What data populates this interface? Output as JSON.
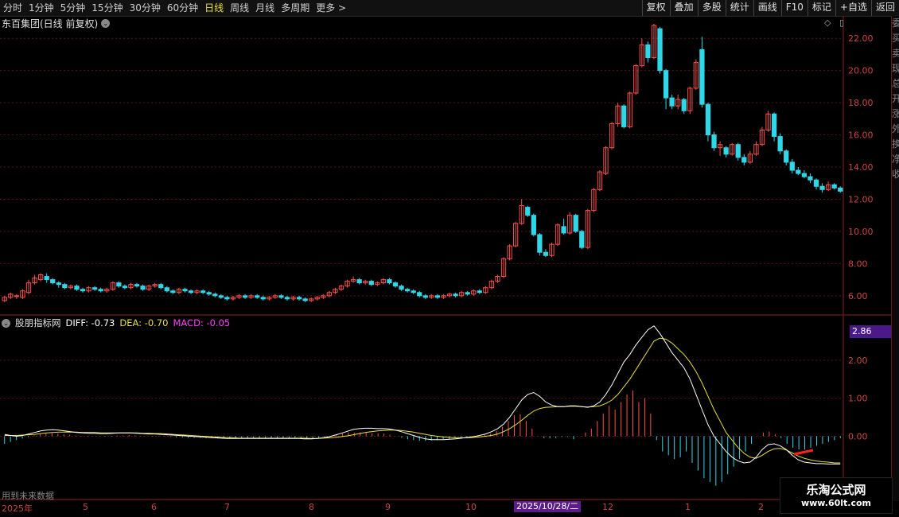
{
  "toolbar": {
    "tabs": [
      {
        "label": "分时",
        "active": false
      },
      {
        "label": "1分钟",
        "active": false
      },
      {
        "label": "5分钟",
        "active": false
      },
      {
        "label": "15分钟",
        "active": false
      },
      {
        "label": "30分钟",
        "active": false
      },
      {
        "label": "60分钟",
        "active": false
      },
      {
        "label": "日线",
        "active": true
      },
      {
        "label": "周线",
        "active": false
      },
      {
        "label": "月线",
        "active": false
      },
      {
        "label": "多周期",
        "active": false
      },
      {
        "label": "更多 >",
        "active": false
      }
    ],
    "buttons": [
      "复权",
      "叠加",
      "多股",
      "统计",
      "画线",
      "F10",
      "标记",
      "+自选",
      "返回"
    ]
  },
  "stock": {
    "title": "东百集团(日线 前复权)"
  },
  "indicator": {
    "name": "股朋指标网",
    "diff": "DIFF: -0.73",
    "dea": "DEA: -0.70",
    "macd": "MACD: -0.05",
    "current_value": "2.86"
  },
  "price_axis": {
    "labels": [
      "22.00",
      "20.00",
      "18.00",
      "16.00",
      "14.00",
      "12.00",
      "10.00",
      "8.00",
      "6.00"
    ]
  },
  "macd_axis": {
    "labels": [
      "2.00",
      "1.00",
      "0.00"
    ]
  },
  "x_axis": {
    "labels": [
      "2025年",
      "5",
      "6",
      "7",
      "8",
      "9",
      "10",
      "12",
      "1",
      "2"
    ],
    "cursor_date": "2025/10/28/二"
  },
  "footer": {
    "note": "用到未来数据"
  },
  "watermark": {
    "line1": "乐淘公式网",
    "line2": "www.60lt.com"
  },
  "right_strip": [
    "委",
    "买",
    "卖",
    "现",
    "总",
    "开",
    "涨",
    "外",
    "换",
    "净",
    "收"
  ],
  "colors": {
    "up": "#ff4d4d",
    "down": "#2fd7e8",
    "diff": "#ffffff",
    "dea": "#e8e23a",
    "macd": "#ff40ff",
    "grid": "#5a1414"
  },
  "chart_data": {
    "type": "candlestick",
    "ylim": [
      5.2,
      23.0
    ],
    "candles": [
      [
        5.7,
        5.9,
        5.6,
        6.0
      ],
      [
        5.9,
        6.1,
        5.8,
        6.2
      ],
      [
        6.0,
        6.0,
        5.8,
        6.1
      ],
      [
        5.9,
        6.3,
        5.8,
        6.4
      ],
      [
        6.2,
        6.8,
        6.1,
        7.0
      ],
      [
        6.8,
        7.1,
        6.7,
        7.3
      ],
      [
        7.0,
        7.3,
        6.9,
        7.4
      ],
      [
        7.2,
        7.0,
        6.8,
        7.4
      ],
      [
        7.0,
        6.8,
        6.7,
        7.1
      ],
      [
        6.8,
        6.7,
        6.5,
        6.9
      ],
      [
        6.7,
        6.5,
        6.4,
        6.8
      ],
      [
        6.5,
        6.6,
        6.4,
        6.7
      ],
      [
        6.6,
        6.4,
        6.3,
        6.7
      ],
      [
        6.4,
        6.3,
        6.2,
        6.5
      ],
      [
        6.3,
        6.5,
        6.2,
        6.6
      ],
      [
        6.5,
        6.4,
        6.3,
        6.6
      ],
      [
        6.4,
        6.3,
        6.2,
        6.5
      ],
      [
        6.3,
        6.4,
        6.2,
        6.5
      ],
      [
        6.4,
        6.8,
        6.3,
        6.9
      ],
      [
        6.8,
        6.6,
        6.5,
        6.9
      ],
      [
        6.6,
        6.5,
        6.4,
        6.7
      ],
      [
        6.5,
        6.7,
        6.4,
        6.8
      ],
      [
        6.7,
        6.6,
        6.5,
        6.8
      ],
      [
        6.6,
        6.4,
        6.3,
        6.7
      ],
      [
        6.4,
        6.6,
        6.3,
        6.7
      ],
      [
        6.6,
        6.7,
        6.5,
        6.8
      ],
      [
        6.7,
        6.5,
        6.4,
        6.8
      ],
      [
        6.5,
        6.3,
        6.2,
        6.6
      ],
      [
        6.3,
        6.2,
        6.1,
        6.4
      ],
      [
        6.2,
        6.4,
        6.1,
        6.5
      ],
      [
        6.4,
        6.3,
        6.2,
        6.5
      ],
      [
        6.3,
        6.2,
        6.1,
        6.4
      ],
      [
        6.2,
        6.3,
        6.1,
        6.4
      ],
      [
        6.3,
        6.2,
        6.1,
        6.4
      ],
      [
        6.2,
        6.1,
        6.0,
        6.3
      ],
      [
        6.1,
        6.0,
        5.9,
        6.2
      ],
      [
        6.0,
        5.9,
        5.8,
        6.1
      ],
      [
        5.9,
        5.8,
        5.7,
        6.0
      ],
      [
        5.8,
        5.9,
        5.7,
        6.0
      ],
      [
        5.9,
        6.0,
        5.8,
        6.1
      ],
      [
        6.0,
        5.9,
        5.8,
        6.1
      ],
      [
        5.9,
        6.0,
        5.8,
        6.1
      ],
      [
        6.0,
        5.9,
        5.8,
        6.1
      ],
      [
        5.9,
        5.8,
        5.7,
        6.0
      ],
      [
        5.8,
        5.9,
        5.7,
        6.0
      ],
      [
        5.9,
        6.0,
        5.8,
        6.1
      ],
      [
        6.0,
        5.9,
        5.8,
        6.1
      ],
      [
        5.9,
        5.8,
        5.7,
        6.0
      ],
      [
        5.8,
        5.9,
        5.7,
        6.0
      ],
      [
        5.9,
        5.8,
        5.7,
        6.0
      ],
      [
        5.8,
        5.7,
        5.6,
        5.9
      ],
      [
        5.7,
        5.8,
        5.6,
        5.9
      ],
      [
        5.8,
        5.9,
        5.7,
        6.0
      ],
      [
        5.9,
        6.0,
        5.8,
        6.1
      ],
      [
        6.0,
        6.2,
        5.9,
        6.3
      ],
      [
        6.2,
        6.4,
        6.1,
        6.5
      ],
      [
        6.4,
        6.6,
        6.3,
        6.7
      ],
      [
        6.6,
        6.9,
        6.5,
        7.0
      ],
      [
        6.9,
        7.0,
        6.8,
        7.2
      ],
      [
        7.0,
        6.8,
        6.7,
        7.1
      ],
      [
        6.8,
        6.9,
        6.7,
        7.0
      ],
      [
        6.9,
        6.7,
        6.6,
        7.0
      ],
      [
        6.7,
        6.8,
        6.6,
        6.9
      ],
      [
        6.8,
        7.0,
        6.7,
        7.1
      ],
      [
        7.0,
        6.8,
        6.7,
        7.1
      ],
      [
        6.8,
        6.6,
        6.5,
        6.9
      ],
      [
        6.6,
        6.4,
        6.3,
        6.7
      ],
      [
        6.4,
        6.3,
        6.2,
        6.5
      ],
      [
        6.3,
        6.2,
        6.1,
        6.4
      ],
      [
        6.2,
        6.0,
        5.9,
        6.3
      ],
      [
        6.0,
        5.9,
        5.8,
        6.1
      ],
      [
        5.9,
        6.0,
        5.8,
        6.1
      ],
      [
        6.0,
        5.9,
        5.8,
        6.1
      ],
      [
        5.9,
        6.0,
        5.8,
        6.1
      ],
      [
        6.0,
        6.1,
        5.9,
        6.2
      ],
      [
        6.1,
        6.0,
        5.9,
        6.2
      ],
      [
        6.0,
        6.2,
        5.9,
        6.3
      ],
      [
        6.2,
        6.1,
        6.0,
        6.3
      ],
      [
        6.1,
        6.3,
        6.0,
        6.4
      ],
      [
        6.3,
        6.2,
        6.1,
        6.4
      ],
      [
        6.2,
        6.5,
        6.1,
        6.6
      ],
      [
        6.5,
        6.9,
        6.4,
        7.0
      ],
      [
        6.9,
        7.2,
        6.8,
        7.3
      ],
      [
        7.2,
        8.3,
        7.1,
        8.4
      ],
      [
        8.3,
        9.1,
        8.2,
        9.2
      ],
      [
        9.1,
        10.5,
        9.0,
        10.6
      ],
      [
        10.5,
        11.6,
        10.4,
        12.0
      ],
      [
        11.5,
        11.0,
        10.9,
        11.6
      ],
      [
        11.0,
        9.8,
        9.7,
        11.1
      ],
      [
        9.8,
        8.7,
        8.5,
        9.9
      ],
      [
        8.7,
        8.5,
        8.4,
        8.9
      ],
      [
        8.5,
        9.2,
        8.4,
        9.3
      ],
      [
        9.2,
        10.4,
        9.1,
        10.5
      ],
      [
        10.3,
        9.9,
        9.8,
        10.8
      ],
      [
        9.9,
        11.0,
        9.8,
        11.2
      ],
      [
        11.0,
        10.0,
        9.9,
        11.1
      ],
      [
        10.0,
        9.0,
        8.9,
        10.1
      ],
      [
        9.0,
        11.3,
        8.9,
        11.4
      ],
      [
        11.3,
        12.6,
        11.2,
        12.7
      ],
      [
        12.6,
        13.7,
        12.5,
        13.8
      ],
      [
        13.6,
        15.2,
        13.5,
        15.3
      ],
      [
        15.2,
        16.7,
        15.1,
        16.8
      ],
      [
        16.7,
        17.8,
        16.5,
        18.0
      ],
      [
        17.8,
        16.5,
        16.4,
        17.9
      ],
      [
        16.5,
        18.6,
        16.4,
        18.7
      ],
      [
        18.6,
        20.3,
        18.5,
        20.4
      ],
      [
        20.3,
        21.6,
        20.2,
        22.0
      ],
      [
        21.6,
        20.8,
        20.5,
        21.8
      ],
      [
        20.8,
        22.8,
        20.7,
        22.9
      ],
      [
        22.6,
        20.0,
        19.8,
        22.7
      ],
      [
        20.0,
        18.3,
        17.6,
        20.1
      ],
      [
        18.3,
        17.8,
        17.6,
        18.5
      ],
      [
        17.8,
        18.2,
        17.6,
        18.5
      ],
      [
        18.2,
        17.5,
        17.3,
        18.3
      ],
      [
        17.5,
        18.9,
        17.3,
        19.0
      ],
      [
        18.9,
        20.5,
        18.8,
        20.7
      ],
      [
        21.3,
        17.9,
        17.7,
        22.1
      ],
      [
        17.9,
        16.0,
        15.6,
        18.0
      ],
      [
        16.0,
        15.2,
        15.0,
        16.2
      ],
      [
        15.2,
        15.4,
        14.7,
        15.6
      ],
      [
        15.2,
        14.8,
        14.6,
        15.3
      ],
      [
        14.8,
        15.4,
        14.7,
        15.5
      ],
      [
        15.4,
        14.6,
        14.4,
        15.5
      ],
      [
        14.6,
        14.3,
        14.1,
        14.8
      ],
      [
        14.3,
        14.8,
        14.2,
        15.0
      ],
      [
        14.8,
        15.4,
        14.7,
        15.6
      ],
      [
        15.4,
        16.3,
        15.3,
        16.5
      ],
      [
        16.3,
        17.3,
        16.2,
        17.5
      ],
      [
        17.3,
        15.9,
        15.6,
        17.4
      ],
      [
        15.9,
        15.0,
        14.8,
        16.1
      ],
      [
        15.0,
        14.3,
        14.1,
        15.1
      ],
      [
        14.3,
        13.8,
        13.6,
        14.5
      ],
      [
        13.8,
        13.6,
        13.5,
        14.0
      ],
      [
        13.6,
        13.4,
        13.3,
        13.8
      ],
      [
        13.4,
        13.2,
        13.0,
        13.6
      ],
      [
        13.2,
        12.8,
        12.6,
        13.3
      ],
      [
        12.8,
        12.6,
        12.4,
        13.0
      ],
      [
        12.6,
        12.9,
        12.5,
        13.1
      ],
      [
        12.9,
        12.7,
        12.6,
        13.0
      ],
      [
        12.7,
        12.5,
        12.4,
        12.8
      ]
    ],
    "macd_ylim": [
      -1.6,
      3.0
    ],
    "macd_hist": [
      -0.2,
      -0.15,
      -0.1,
      -0.06,
      -0.02,
      0.02,
      0.05,
      0.07,
      0.08,
      0.07,
      0.05,
      0.04,
      0.02,
      0.01,
      0.01,
      0.0,
      0.0,
      -0.01,
      0.01,
      0.02,
      0.02,
      0.03,
      0.02,
      0.01,
      0.0,
      0.01,
      0.01,
      -0.01,
      -0.02,
      -0.03,
      -0.03,
      -0.04,
      -0.04,
      -0.04,
      -0.05,
      -0.05,
      -0.06,
      -0.06,
      -0.06,
      -0.06,
      -0.05,
      -0.05,
      -0.05,
      -0.05,
      -0.05,
      -0.05,
      -0.05,
      -0.05,
      -0.05,
      -0.05,
      -0.06,
      -0.06,
      -0.05,
      -0.04,
      -0.02,
      0.0,
      0.03,
      0.07,
      0.1,
      0.1,
      0.1,
      0.09,
      0.08,
      0.08,
      0.07,
      0.04,
      0.0,
      -0.04,
      -0.08,
      -0.1,
      -0.12,
      -0.12,
      -0.11,
      -0.1,
      -0.08,
      -0.07,
      -0.05,
      -0.04,
      -0.02,
      -0.01,
      0.01,
      0.04,
      0.07,
      0.14,
      0.25,
      0.4,
      0.55,
      0.58,
      0.4,
      0.2,
      0.0,
      -0.05,
      -0.05,
      -0.05,
      -0.02,
      -0.02,
      -0.08,
      0.0,
      0.1,
      0.2,
      0.4,
      0.6,
      0.8,
      0.7,
      0.9,
      1.1,
      1.2,
      0.9,
      1.0,
      0.6,
      -0.1,
      -0.4,
      -0.5,
      -0.6,
      -0.55,
      -0.4,
      -0.7,
      -0.9,
      -1.1,
      -1.2,
      -1.3,
      -1.2,
      -1.0,
      -0.8,
      -0.6,
      -0.4,
      -0.2,
      0.0,
      0.1,
      0.12,
      0.05,
      -0.05,
      -0.2,
      -0.3,
      -0.35,
      -0.35,
      -0.3,
      -0.25,
      -0.2,
      -0.15,
      -0.1,
      -0.05
    ],
    "diff": [
      0.05,
      0.02,
      0.0,
      0.02,
      0.06,
      0.1,
      0.14,
      0.16,
      0.17,
      0.16,
      0.14,
      0.12,
      0.1,
      0.09,
      0.08,
      0.08,
      0.07,
      0.07,
      0.08,
      0.09,
      0.09,
      0.09,
      0.08,
      0.07,
      0.06,
      0.06,
      0.05,
      0.04,
      0.03,
      0.02,
      0.01,
      0.0,
      -0.01,
      -0.02,
      -0.03,
      -0.04,
      -0.05,
      -0.06,
      -0.06,
      -0.06,
      -0.06,
      -0.06,
      -0.06,
      -0.06,
      -0.06,
      -0.06,
      -0.06,
      -0.06,
      -0.06,
      -0.06,
      -0.07,
      -0.07,
      -0.06,
      -0.04,
      -0.01,
      0.03,
      0.08,
      0.13,
      0.18,
      0.2,
      0.21,
      0.21,
      0.2,
      0.2,
      0.19,
      0.16,
      0.12,
      0.07,
      0.02,
      -0.03,
      -0.07,
      -0.09,
      -0.09,
      -0.09,
      -0.08,
      -0.07,
      -0.05,
      -0.03,
      -0.01,
      0.02,
      0.06,
      0.12,
      0.2,
      0.32,
      0.5,
      0.72,
      0.95,
      1.1,
      1.15,
      1.05,
      0.9,
      0.82,
      0.78,
      0.78,
      0.8,
      0.8,
      0.78,
      0.76,
      0.8,
      0.9,
      1.1,
      1.35,
      1.65,
      1.95,
      2.15,
      2.4,
      2.6,
      2.8,
      2.9,
      2.7,
      2.45,
      2.2,
      2.0,
      1.8,
      1.5,
      1.1,
      0.7,
      0.3,
      0.0,
      -0.2,
      -0.4,
      -0.55,
      -0.65,
      -0.7,
      -0.68,
      -0.55,
      -0.35,
      -0.22,
      -0.2,
      -0.25,
      -0.35,
      -0.5,
      -0.62,
      -0.68,
      -0.7,
      -0.72,
      -0.72,
      -0.73,
      -0.73,
      -0.73
    ],
    "dea": [
      0.02,
      0.02,
      0.02,
      0.03,
      0.04,
      0.05,
      0.07,
      0.09,
      0.1,
      0.11,
      0.11,
      0.11,
      0.11,
      0.1,
      0.1,
      0.1,
      0.09,
      0.09,
      0.09,
      0.09,
      0.09,
      0.09,
      0.09,
      0.08,
      0.08,
      0.07,
      0.07,
      0.06,
      0.05,
      0.04,
      0.03,
      0.02,
      0.01,
      0.0,
      -0.01,
      -0.02,
      -0.03,
      -0.04,
      -0.04,
      -0.05,
      -0.05,
      -0.05,
      -0.05,
      -0.05,
      -0.05,
      -0.05,
      -0.05,
      -0.05,
      -0.05,
      -0.05,
      -0.05,
      -0.06,
      -0.06,
      -0.05,
      -0.04,
      -0.03,
      -0.01,
      0.01,
      0.04,
      0.07,
      0.1,
      0.12,
      0.14,
      0.15,
      0.16,
      0.16,
      0.15,
      0.13,
      0.11,
      0.08,
      0.05,
      0.02,
      0.0,
      -0.02,
      -0.03,
      -0.04,
      -0.04,
      -0.04,
      -0.03,
      -0.02,
      0.0,
      0.02,
      0.06,
      0.12,
      0.2,
      0.3,
      0.42,
      0.55,
      0.66,
      0.73,
      0.76,
      0.77,
      0.78,
      0.78,
      0.79,
      0.79,
      0.78,
      0.77,
      0.78,
      0.8,
      0.86,
      0.95,
      1.1,
      1.3,
      1.5,
      1.75,
      2.0,
      2.25,
      2.5,
      2.58,
      2.55,
      2.45,
      2.3,
      2.15,
      1.95,
      1.7,
      1.4,
      1.05,
      0.7,
      0.4,
      0.1,
      -0.1,
      -0.3,
      -0.45,
      -0.55,
      -0.58,
      -0.5,
      -0.4,
      -0.33,
      -0.32,
      -0.36,
      -0.44,
      -0.52,
      -0.58,
      -0.62,
      -0.65,
      -0.67,
      -0.68,
      -0.7,
      -0.7
    ]
  }
}
